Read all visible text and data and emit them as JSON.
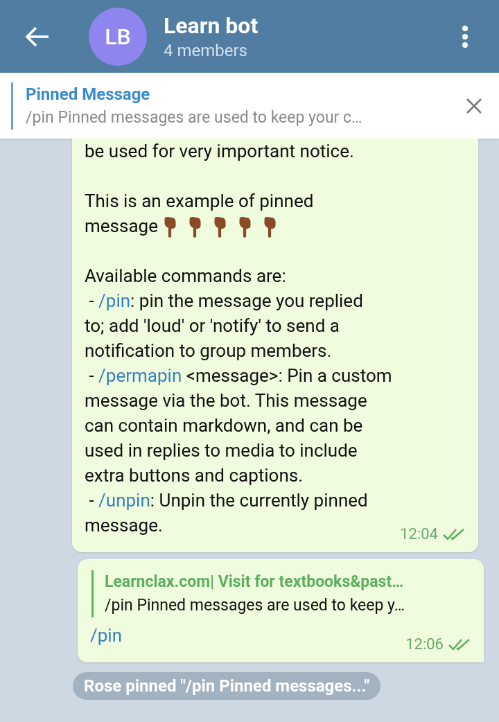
{
  "header": {
    "avatar_initials": "LB",
    "title": "Learn bot",
    "subtitle": "4 members"
  },
  "pinned_bar": {
    "title": "Pinned Message",
    "preview": "/pin Pinned messages are used to keep your c…"
  },
  "messages": [
    {
      "kind": "text",
      "time": "12:04",
      "read": true,
      "body": [
        {
          "kind": "text",
          "text": "be used for very important notice.\n\nThis is an example of pinned\nmessage "
        },
        {
          "kind": "emoji"
        },
        {
          "kind": "emoji"
        },
        {
          "kind": "emoji"
        },
        {
          "kind": "emoji"
        },
        {
          "kind": "emoji"
        },
        {
          "kind": "text",
          "text": "\n\nAvailable commands are:\n - "
        },
        {
          "kind": "command",
          "text": "/pin"
        },
        {
          "kind": "text",
          "text": ": pin the message you replied\nto; add 'loud' or 'notify' to send a\nnotification to group members.\n - "
        },
        {
          "kind": "command",
          "text": "/permapin"
        },
        {
          "kind": "text",
          "text": " <message>: Pin a custom\nmessage via the bot. This message\ncan contain markdown, and can be\nused in replies to media to include\nextra buttons and captions.\n - "
        },
        {
          "kind": "command",
          "text": "/unpin"
        },
        {
          "kind": "text",
          "text": ": Unpin the currently pinned\nmessage."
        }
      ]
    },
    {
      "kind": "reply",
      "time": "12:06",
      "read": true,
      "reply": {
        "author": "Learnclax.com| Visit for textbooks&past…",
        "preview": "/pin Pinned messages are used to keep y…"
      },
      "body": [
        {
          "kind": "command",
          "text": "/pin"
        }
      ]
    }
  ],
  "service_message": "Rose pinned \"/pin Pinned messages...\""
}
